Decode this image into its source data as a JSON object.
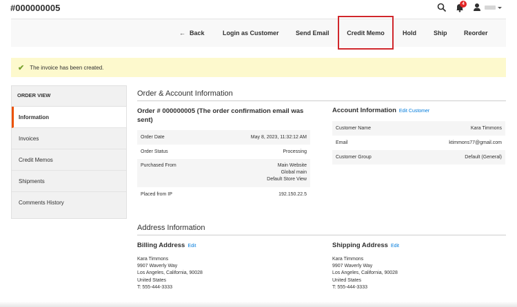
{
  "page": {
    "title": "#000000005"
  },
  "header": {
    "notification_count": "4"
  },
  "toolbar": {
    "back_label": "Back",
    "back_arrow": "←",
    "login_label": "Login as Customer",
    "email_label": "Send Email",
    "memo_label": "Credit Memo",
    "hold_label": "Hold",
    "ship_label": "Ship",
    "reorder_label": "Reorder"
  },
  "message": {
    "text": "The invoice has been created.",
    "icon": "✔"
  },
  "sidebar": {
    "title": "ORDER VIEW",
    "items": [
      {
        "label": "Information"
      },
      {
        "label": "Invoices"
      },
      {
        "label": "Credit Memos"
      },
      {
        "label": "Shipments"
      },
      {
        "label": "Comments History"
      }
    ]
  },
  "order_account": {
    "section_title": "Order & Account Information",
    "order_title": "Order # 000000005 (The order confirmation email was sent)",
    "order_date_label": "Order Date",
    "order_date": "May 8, 2023, 11:32:12 AM",
    "order_status_label": "Order Status",
    "order_status": "Processing",
    "purchased_from_label": "Purchased From",
    "purchased_from": [
      "Main Website",
      "Global main",
      "Default Store View"
    ],
    "placed_ip_label": "Placed from IP",
    "placed_ip": "192.150.22.5"
  },
  "account": {
    "title": "Account Information",
    "edit_label": "Edit Customer",
    "name_label": "Customer Name",
    "name": "Kara Timmons",
    "email_label": "Email",
    "email": "ktimmons77@gmail.com",
    "group_label": "Customer Group",
    "group": "Default (General)"
  },
  "address": {
    "section_title": "Address Information",
    "billing_title": "Billing Address",
    "billing_edit": "Edit",
    "billing_lines": [
      "Kara Timmons",
      "9907 Waverly Way",
      "Los Angeles, California, 90028",
      "United States"
    ],
    "billing_phone": "T: 555-444-3333",
    "shipping_title": "Shipping Address",
    "shipping_edit": "Edit",
    "shipping_lines": [
      "Kara Timmons",
      "9907 Waverly Way",
      "Los Angeles, California, 90028",
      "United States"
    ],
    "shipping_phone": "T: 555-444-3333"
  }
}
